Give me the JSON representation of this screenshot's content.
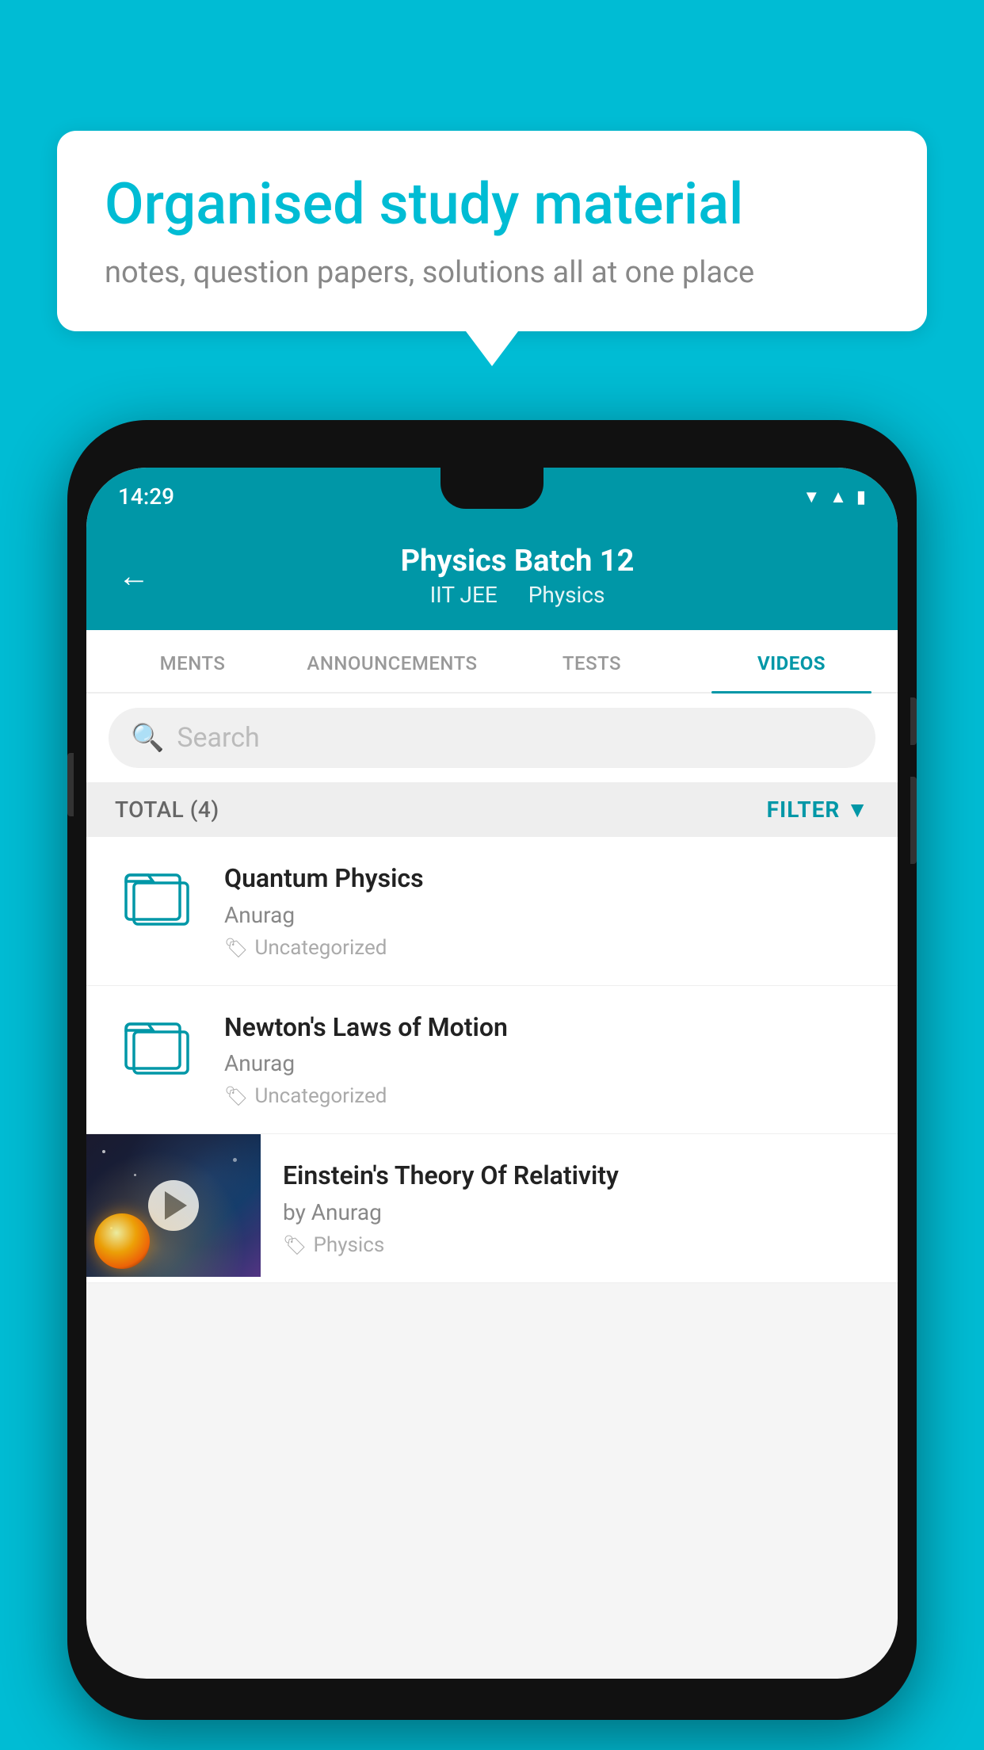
{
  "background_color": "#00BCD4",
  "speech_bubble": {
    "title": "Organised study material",
    "subtitle": "notes, question papers, solutions all at one place"
  },
  "status_bar": {
    "time": "14:29",
    "icons": [
      "wifi",
      "signal",
      "battery"
    ]
  },
  "app_header": {
    "back_label": "←",
    "title": "Physics Batch 12",
    "subtitle_part1": "IIT JEE",
    "subtitle_part2": "Physics"
  },
  "tabs": [
    {
      "label": "MENTS",
      "active": false
    },
    {
      "label": "ANNOUNCEMENTS",
      "active": false
    },
    {
      "label": "TESTS",
      "active": false
    },
    {
      "label": "VIDEOS",
      "active": true
    }
  ],
  "search": {
    "placeholder": "Search"
  },
  "filter_row": {
    "total_label": "TOTAL (4)",
    "filter_label": "FILTER"
  },
  "videos": [
    {
      "id": 1,
      "title": "Quantum Physics",
      "author": "Anurag",
      "tag": "Uncategorized",
      "has_thumbnail": false
    },
    {
      "id": 2,
      "title": "Newton's Laws of Motion",
      "author": "Anurag",
      "tag": "Uncategorized",
      "has_thumbnail": false
    },
    {
      "id": 3,
      "title": "Einstein's Theory Of Relativity",
      "author": "by Anurag",
      "tag": "Physics",
      "has_thumbnail": true
    }
  ]
}
